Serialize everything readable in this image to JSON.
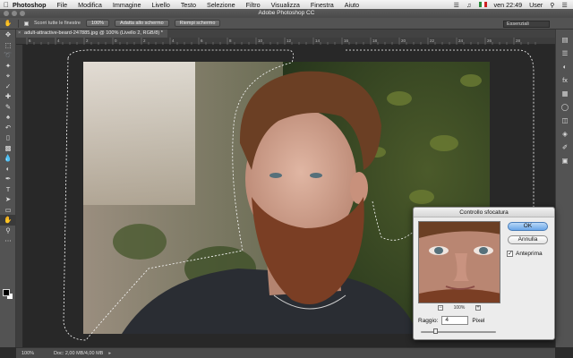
{
  "menubar": {
    "app_name": "Photoshop",
    "items": [
      "File",
      "Modifica",
      "Immagine",
      "Livello",
      "Testo",
      "Selezione",
      "Filtro",
      "Visualizza",
      "Finestra",
      "Aiuto"
    ],
    "clock": "ven 22:49",
    "user": "User"
  },
  "window": {
    "title": "Adobe Photoshop CC"
  },
  "options": {
    "scroll_all_label": "Scorri tutte le finestre",
    "btn_100": "100%",
    "btn_fit": "Adatta allo schermo",
    "btn_fill": "Riempi schermo",
    "workspace": "Essenziali"
  },
  "document": {
    "tab_title": "adult-attractive-beard-247885.jpg @ 100% (Livello 2, RGB/8) *",
    "ruler_ticks": [
      "6",
      "4",
      "2",
      "0",
      "2",
      "4",
      "6",
      "8",
      "10",
      "12",
      "14",
      "16",
      "18",
      "20",
      "22",
      "24",
      "26",
      "28"
    ]
  },
  "status": {
    "zoom": "100%",
    "doc_info": "Doc: 2,00 MB/4,00 MB"
  },
  "dialog": {
    "title": "Controllo sfocatura",
    "ok_label": "OK",
    "cancel_label": "Annulla",
    "preview_label": "Anteprima",
    "preview_checked": true,
    "zoom_value": "100%",
    "radius_label": "Raggio:",
    "radius_value": "4",
    "radius_unit": "Pixel",
    "radius_slider_fraction": 0.2
  },
  "icons": {
    "tools": [
      "move-icon",
      "marquee-icon",
      "lasso-icon",
      "magic-wand-icon",
      "crop-icon",
      "eyedropper-icon",
      "healing-icon",
      "brush-icon",
      "stamp-icon",
      "history-brush-icon",
      "eraser-icon",
      "gradient-icon",
      "blur-icon",
      "dodge-icon",
      "pen-icon",
      "type-icon",
      "path-select-icon",
      "shape-icon",
      "hand-icon",
      "zoom-icon"
    ],
    "panels": [
      "history-panel-icon",
      "properties-panel-icon",
      "adjustments-panel-icon",
      "styles-panel-icon",
      "swatches-panel-icon",
      "color-panel-icon",
      "layers-panel-icon",
      "channels-panel-icon",
      "paths-panel-icon",
      "libraries-panel-icon"
    ]
  }
}
